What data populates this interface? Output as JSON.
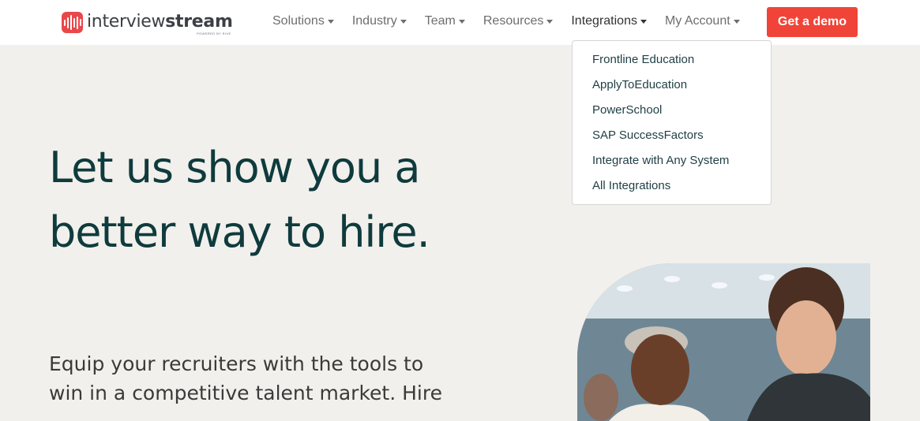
{
  "brand": {
    "name_light": "interview",
    "name_bold": "stream",
    "tagline": "POWERED BY RIVE",
    "accent_color": "#f04438",
    "text_dark": "#0f3b3d"
  },
  "nav": {
    "items": [
      {
        "label": "Solutions"
      },
      {
        "label": "Industry"
      },
      {
        "label": "Team"
      },
      {
        "label": "Resources"
      },
      {
        "label": "Integrations"
      },
      {
        "label": "My Account"
      }
    ],
    "cta_label": "Get a demo"
  },
  "dropdown": {
    "items": [
      {
        "label": "Frontline Education"
      },
      {
        "label": "ApplyToEducation"
      },
      {
        "label": "PowerSchool"
      },
      {
        "label": "SAP SuccessFactors"
      },
      {
        "label": "Integrate with Any System"
      },
      {
        "label": "All Integrations"
      }
    ]
  },
  "hero": {
    "title": "Let us show you a better way to hire.",
    "subtitle": "Equip your recruiters with the tools to win in a competitive talent market. Hire"
  }
}
